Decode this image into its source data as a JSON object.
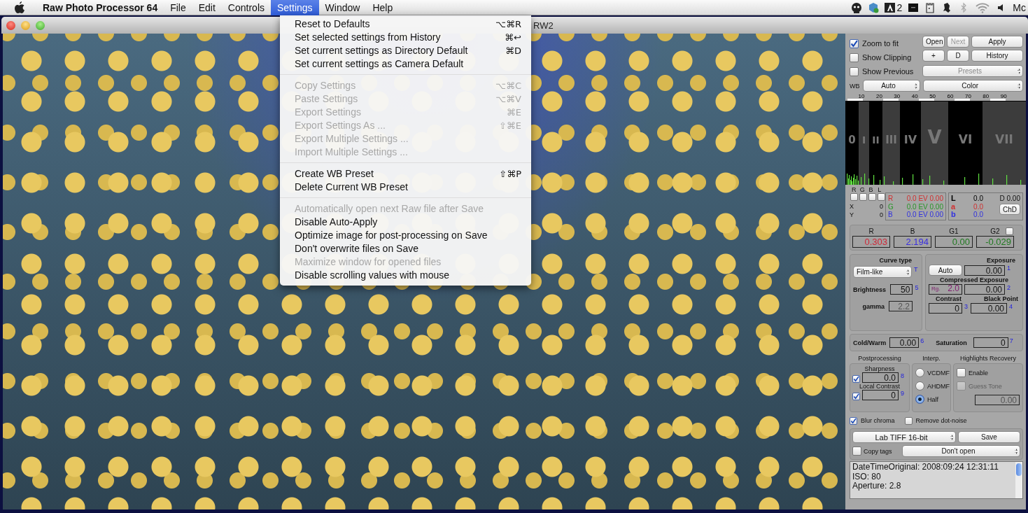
{
  "menu_bar": {
    "items": [
      {
        "label": "Raw Photo Processor 64",
        "kind": "app",
        "selected": false
      },
      {
        "label": "File",
        "kind": "menu",
        "selected": false
      },
      {
        "label": "Edit",
        "kind": "menu",
        "selected": false
      },
      {
        "label": "Controls",
        "kind": "menu",
        "selected": false
      },
      {
        "label": "Settings",
        "kind": "menu",
        "selected": true
      },
      {
        "label": "Window",
        "kind": "menu",
        "selected": false
      },
      {
        "label": "Help",
        "kind": "menu",
        "selected": false
      }
    ],
    "adobe_count": "2",
    "clock": "Mc"
  },
  "window": {
    "title": "RW2"
  },
  "settings_menu": {
    "groups": [
      {
        "items": [
          {
            "label": "Reset to Defaults",
            "shortcut": "⌥⌘R",
            "disabled": false
          },
          {
            "label": "Set selected settings from History",
            "shortcut": "⌘↩",
            "disabled": false
          },
          {
            "label": "Set current settings as Directory Default",
            "shortcut": "⌘D",
            "disabled": false
          },
          {
            "label": "Set current settings as Camera Default",
            "disabled": false
          }
        ]
      },
      {
        "items": [
          {
            "label": "Copy Settings",
            "shortcut": "⌥⌘C",
            "disabled": true
          },
          {
            "label": "Paste Settings",
            "shortcut": "⌥⌘V",
            "disabled": true
          },
          {
            "label": "Export Settings",
            "shortcut": "⌘E",
            "disabled": true
          },
          {
            "label": "Export Settings As ...",
            "shortcut": "⇧⌘E",
            "disabled": true
          },
          {
            "label": "Export Multiple Settings ...",
            "disabled": true
          },
          {
            "label": "Import Multiple Settings ...",
            "disabled": true
          }
        ]
      },
      {
        "items": [
          {
            "label": "Create WB Preset",
            "shortcut": "⇧⌘P",
            "disabled": false
          },
          {
            "label": "Delete Current WB Preset",
            "disabled": false
          }
        ]
      },
      {
        "items": [
          {
            "label": "Automatically open next Raw file after Save",
            "disabled": true
          },
          {
            "label": "Disable Auto-Apply",
            "disabled": false
          },
          {
            "label": "Optimize image for post-processing on Save",
            "disabled": false
          },
          {
            "label": "Don't overwrite files on Save",
            "disabled": false
          },
          {
            "label": "Maximize window for opened files",
            "disabled": true
          },
          {
            "label": "Disable scrolling values with mouse",
            "disabled": false
          }
        ]
      }
    ]
  },
  "panel": {
    "toggles": [
      {
        "label": "Zoom to fit",
        "checked": true
      },
      {
        "label": "Show Clipping",
        "checked": false
      },
      {
        "label": "Show Previous",
        "checked": false
      }
    ],
    "buttons": [
      {
        "label": "Open",
        "disabled": false
      },
      {
        "label": "Next",
        "disabled": true
      },
      {
        "label": "Apply",
        "disabled": false
      },
      {
        "label": "+",
        "disabled": false
      },
      {
        "label": "D",
        "disabled": false
      },
      {
        "label": "History",
        "disabled": false
      }
    ],
    "presets": {
      "label": "Presets",
      "disabled": true
    },
    "wb": {
      "label": "WB",
      "mode": "Auto",
      "color_mode": "Color"
    },
    "histogram": {
      "ticks": [
        "10",
        "20",
        "30",
        "40",
        "50",
        "60",
        "70",
        "80",
        "90"
      ],
      "zones": [
        "0",
        "I",
        "II",
        "III",
        "IV",
        "V",
        "VI",
        "VII"
      ]
    },
    "channels": [
      {
        "label": "R",
        "checked": false
      },
      {
        "label": "G",
        "checked": false
      },
      {
        "label": "B",
        "checked": false
      },
      {
        "label": "L",
        "checked": false
      }
    ],
    "x": {
      "label": "X",
      "value": "0"
    },
    "y": {
      "label": "Y",
      "value": "0"
    },
    "ev_rows": [
      {
        "channel": "R",
        "reading": "0.0 EV 0.00",
        "color": "#d03030"
      },
      {
        "channel": "G",
        "reading": "0.0 EV 0.00",
        "color": "#289628"
      },
      {
        "channel": "B",
        "reading": "0.0 EV 0.00",
        "color": "#3030e0"
      }
    ],
    "lab": [
      {
        "channel": "L",
        "value": "0.0",
        "color": "#000000"
      },
      {
        "channel": "a",
        "value": "0.0",
        "color": "#d03030"
      },
      {
        "channel": "b",
        "value": "0.0",
        "color": "#3030e0"
      }
    ],
    "d_reading": "D 0.00",
    "chd_button": "ChD",
    "coefficients": [
      {
        "label": "R",
        "value": "0.303",
        "color": "#d02838"
      },
      {
        "label": "B",
        "value": "2.194",
        "color": "#3a2ee0"
      },
      {
        "label": "G1",
        "value": "0.00",
        "color": "#207a20"
      },
      {
        "label": "G2",
        "value": "-0.029",
        "color": "#207a20"
      }
    ],
    "g2_lock": {
      "checked": false
    },
    "curve": {
      "title": "Curve type",
      "type": "Film-like",
      "type_hint": "T",
      "brightness": {
        "label": "Brightness",
        "value": "50",
        "hint": "5"
      },
      "gamma": {
        "label": "gamma",
        "value": "2.2",
        "disabled": true
      }
    },
    "exposure": {
      "title": "Exposure",
      "auto_button": "Auto",
      "value": "0.00",
      "hint": "1",
      "compressed": {
        "title": "Compressed Exposure",
        "range_label": "Rg.",
        "range": "2.0",
        "value": "0.00",
        "hint": "2"
      },
      "contrast": {
        "label": "Contrast",
        "value": "0",
        "hint": "3"
      },
      "black_point": {
        "label": "Black Point",
        "value": "0.00",
        "hint": "4"
      }
    },
    "cold_warm": {
      "label": "Cold/Warm",
      "value": "0.00",
      "hint": "6"
    },
    "saturation": {
      "label": "Saturation",
      "value": "0",
      "hint": "7"
    },
    "postprocessing": {
      "title": "Postprocessing",
      "sharpness": {
        "label": "Sharpness",
        "value": "0.0",
        "hint": "8",
        "checked": true
      },
      "local_contrast": {
        "label": "Local Contrast",
        "value": "0",
        "hint": "9",
        "checked": true
      }
    },
    "interpolation": {
      "title": "Interp.",
      "options": [
        {
          "label": "VCDMF",
          "selected": false
        },
        {
          "label": "AHDMF",
          "selected": false
        },
        {
          "label": "Half",
          "selected": true
        }
      ]
    },
    "highlights": {
      "title": "Highlights Recovery",
      "enable": {
        "label": "Enable",
        "checked": false
      },
      "guess_tone": {
        "label": "Guess Tone",
        "checked": false,
        "disabled": true
      },
      "value": "0.00"
    },
    "noise": [
      {
        "label": "Blur chroma",
        "checked": true
      },
      {
        "label": "Remove dot-noise",
        "checked": false
      }
    ],
    "output": {
      "format": "Lab TIFF 16-bit",
      "save_button": "Save",
      "copy_tags": {
        "label": "Copy tags",
        "checked": false
      },
      "after_save": "Don't open"
    },
    "info_lines": [
      "DateTimeOriginal: 2008:09:24 12:31:11",
      "ISO: 80",
      "Aperture: 2.8"
    ]
  }
}
